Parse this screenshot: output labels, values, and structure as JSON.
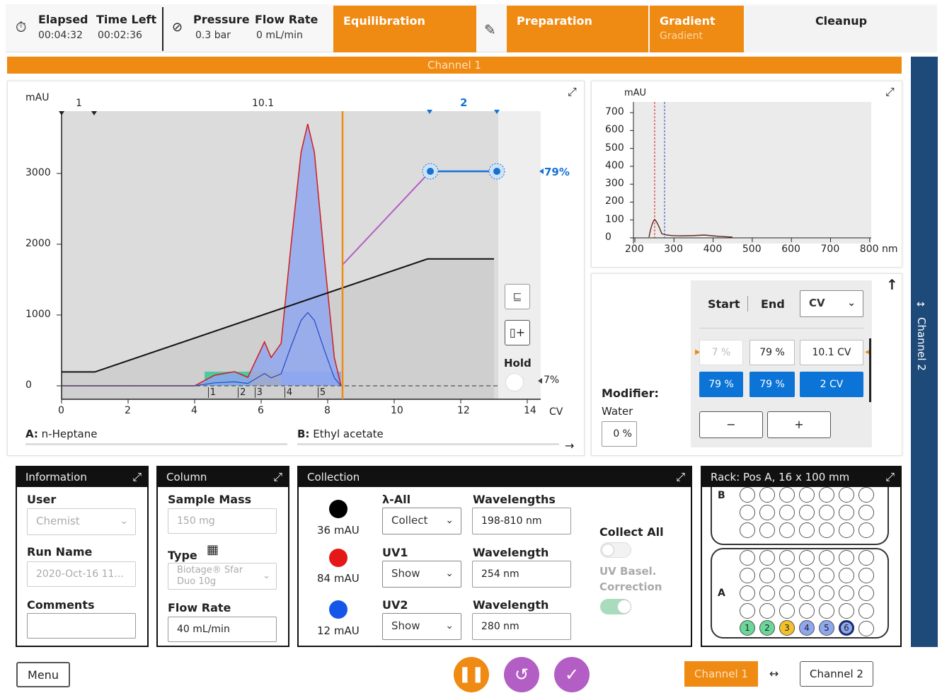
{
  "header": {
    "elapsed_label": "Elapsed",
    "elapsed_value": "00:04:32",
    "timeleft_label": "Time Left",
    "timeleft_value": "00:02:36",
    "pressure_label": "Pressure",
    "pressure_value": "0.3 bar",
    "flowrate_label": "Flow Rate",
    "flowrate_value": "0 mL/min"
  },
  "tabs": {
    "equilibration": "Equilibration",
    "preparation": "Preparation",
    "gradient": "Gradient",
    "gradient_sub": "Gradient",
    "cleanup": "Cleanup"
  },
  "channel_bar": "Channel 1",
  "side_tab": "Channel 2",
  "main_chart": {
    "ylabel": "mAU",
    "xlabel": "CV",
    "y_ticks": [
      "3000",
      "2000",
      "1000",
      "0"
    ],
    "x_ticks": [
      "0",
      "2",
      "4",
      "6",
      "8",
      "10",
      "12",
      "14"
    ],
    "marker_1": "1",
    "marker_101": "10.1",
    "marker_2": "2",
    "pct_high": "79%",
    "pct_low": "7%",
    "fractions": [
      "1",
      "2",
      "3",
      "4",
      "5"
    ],
    "hold_label": "Hold",
    "solvent_a_key": "A:",
    "solvent_a": "n-Heptane",
    "solvent_b_key": "B:",
    "solvent_b": "Ethyl acetate"
  },
  "chart_data": {
    "type": "line",
    "xlabel": "CV",
    "ylabel": "mAU",
    "xlim": [
      0,
      15
    ],
    "ylim": [
      0,
      3800
    ],
    "series": [
      {
        "x": [
          0,
          4,
          4.6,
          5.2,
          5.6,
          5.9,
          6.1,
          6.3,
          6.6,
          6.9,
          7.2,
          7.4,
          7.6,
          7.9,
          8.2,
          8.4
        ],
        "y": [
          0,
          0,
          150,
          200,
          120,
          420,
          620,
          400,
          600,
          2000,
          3300,
          3700,
          3300,
          1800,
          400,
          0
        ]
      },
      {
        "x": [
          0,
          1,
          11,
          13
        ],
        "y": [
          7,
          7,
          79,
          79
        ]
      }
    ]
  },
  "spectrum": {
    "ylabel": "mAU",
    "xlabel": "nm",
    "y_ticks": [
      "700",
      "600",
      "500",
      "400",
      "300",
      "200",
      "100",
      "0"
    ],
    "x_ticks": [
      "200",
      "300",
      "400",
      "500",
      "600",
      "700",
      "800"
    ]
  },
  "gradient_table": {
    "start_label": "Start",
    "end_label": "End",
    "unit_select": "CV",
    "row1": [
      "7 %",
      "79 %",
      "10.1 CV"
    ],
    "row2": [
      "79 %",
      "79 %",
      "2 CV"
    ],
    "modifier_label": "Modifier:",
    "modifier_solvent": "Water",
    "modifier_value": "0 %",
    "minus": "−",
    "plus": "+"
  },
  "information": {
    "title": "Information",
    "user_label": "User",
    "user_value": "Chemist",
    "run_label": "Run Name",
    "run_value": "2020-Oct-16 11...",
    "comments_label": "Comments",
    "comments_value": ""
  },
  "column": {
    "title": "Column",
    "mass_label": "Sample Mass",
    "mass_value": "150 mg",
    "type_label": "Type",
    "type_value_1": "Biotage® Sfar",
    "type_value_2": "Duo 10g",
    "flow_label": "Flow Rate",
    "flow_value": "40 mL/min"
  },
  "collection": {
    "title": "Collection",
    "black_mau": "36 mAU",
    "red_mau": "84 mAU",
    "blue_mau": "12 mAU",
    "lambda_all_label": "λ-All",
    "lambda_all_value": "Collect",
    "uv1_label": "UV1",
    "uv1_value": "Show",
    "uv2_label": "UV2",
    "uv2_value": "Show",
    "wl_all_label": "Wavelengths",
    "wl_all_value": "198-810 nm",
    "wl1_label": "Wavelength",
    "wl1_value": "254 nm",
    "wl2_label": "Wavelength",
    "wl2_value": "280 nm",
    "collect_all_label": "Collect All",
    "uv_baseline_label_1": "UV Basel.",
    "uv_baseline_label_2": "Correction",
    "colors": {
      "black": "#000000",
      "red": "#e41818",
      "blue": "#1456e8"
    }
  },
  "rack": {
    "title": "Rack: Pos A, 16 x 100 mm",
    "label_b": "B",
    "label_a": "A",
    "tubes": [
      "1",
      "2",
      "3",
      "4",
      "5",
      "6"
    ]
  },
  "footer": {
    "menu": "Menu",
    "channel1": "Channel 1",
    "channel2": "Channel 2"
  },
  "colors": {
    "accent_orange": "#ef8a12",
    "blue": "#0b74d6",
    "purple": "#b35ec4",
    "navy": "#1e4a7a"
  }
}
